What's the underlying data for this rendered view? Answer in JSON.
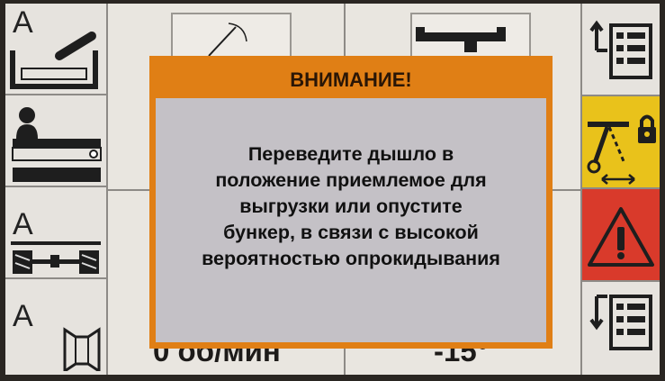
{
  "colors": {
    "dialog_frame": "#e07f15",
    "dialog_body": "#c4c1c6",
    "warning_red": "#d93a2b",
    "lock_yellow": "#e9c21b"
  },
  "left_buttons": [
    {
      "letter": "A",
      "icon": "hopper-auto-icon"
    },
    {
      "letter": "",
      "icon": "operator-conveyor-icon"
    },
    {
      "letter": "A",
      "icon": "axle-steering-auto-icon"
    },
    {
      "letter": "A",
      "icon": "spout-auto-icon"
    }
  ],
  "right_buttons": [
    {
      "icon": "menu-up-list-icon"
    },
    {
      "icon": "drawbar-lock-icon"
    },
    {
      "icon": "warning-triangle-icon"
    },
    {
      "icon": "menu-down-list-icon"
    }
  ],
  "readouts": {
    "speed": "0 об/мин",
    "angle": "-15°"
  },
  "dialog": {
    "title": "ВНИМАНИЕ!",
    "message_lines": [
      "Переведите дышло в",
      "положение приемлемое для",
      "выгрузки или опустите",
      "бункер, в связи с высокой",
      "вероятностью опрокидывания"
    ]
  }
}
